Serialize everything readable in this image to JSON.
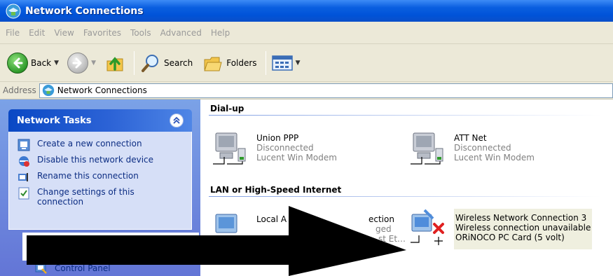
{
  "window": {
    "title": "Network Connections"
  },
  "menu": [
    "File",
    "Edit",
    "View",
    "Favorites",
    "Tools",
    "Advanced",
    "Help"
  ],
  "toolbar": {
    "back_label": "Back",
    "search_label": "Search",
    "folders_label": "Folders"
  },
  "address": {
    "label": "Address",
    "value": "Network Connections"
  },
  "tasks": {
    "title": "Network Tasks",
    "items": [
      {
        "label": "Create a new connection"
      },
      {
        "label": "Disable this network device"
      },
      {
        "label": "Rename this connection"
      },
      {
        "label": "Change settings of this connection"
      }
    ],
    "control_panel": "Control Panel"
  },
  "groups": {
    "dialup": {
      "title": "Dial-up",
      "items": [
        {
          "name": "Union PPP",
          "status": "Disconnected",
          "device": "Lucent Win Modem"
        },
        {
          "name": "ATT Net",
          "status": "Disconnected",
          "device": "Lucent Win Modem"
        }
      ]
    },
    "lan": {
      "title": "LAN or High-Speed Internet",
      "items": [
        {
          "name": "Local A",
          "name_tail": "ection",
          "status_tail": "ged",
          "device_tail": "st Et…"
        },
        {
          "name": "Wireless Network Connection 3",
          "status": "Wireless connection unavailable",
          "device": "ORiNOCO PC Card (5 volt)"
        }
      ]
    }
  },
  "colors": {
    "titlebar": "#0053d8",
    "taskpane": "#6375d6",
    "link": "#0c2d83",
    "arrow": "#000000"
  }
}
